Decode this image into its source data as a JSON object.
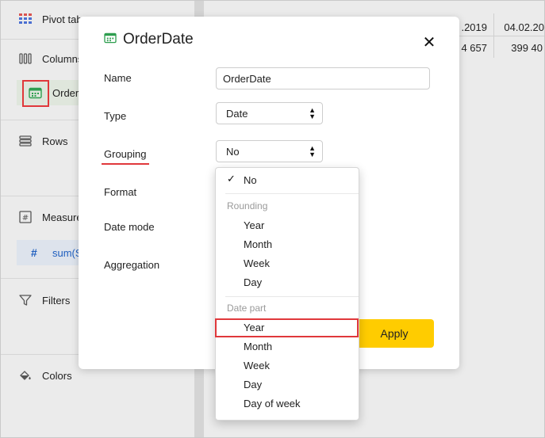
{
  "sidebar": {
    "pivot_label": "Pivot tab",
    "columns_label": "Columns",
    "column_field": "Order",
    "rows_label": "Rows",
    "measures_label": "Measure",
    "measure_field": "sum(S",
    "filters_label": "Filters",
    "colors_label": "Colors"
  },
  "table": {
    "col1_header": ".2019",
    "col1_value": "4 657",
    "col2_header": "04.02.20",
    "col2_value": "399 40"
  },
  "dialog": {
    "title": "OrderDate",
    "labels": {
      "name": "Name",
      "type": "Type",
      "grouping": "Grouping",
      "format": "Format",
      "date_mode": "Date mode",
      "aggregation": "Aggregation"
    },
    "name_value": "OrderDate",
    "type_value": "Date",
    "grouping_value": "No",
    "apply_label": "Apply"
  },
  "dropdown": {
    "selected": "No",
    "group1_title": "Rounding",
    "group1_items": [
      "Year",
      "Month",
      "Week",
      "Day"
    ],
    "group2_title": "Date part",
    "group2_items": [
      "Year",
      "Month",
      "Week",
      "Day",
      "Day of week"
    ]
  },
  "colors": {
    "accent_yellow": "#ffcc00",
    "highlight_red": "#e0383b",
    "dimension_green": "#2e9e4f",
    "measure_blue": "#1f5fbf"
  }
}
